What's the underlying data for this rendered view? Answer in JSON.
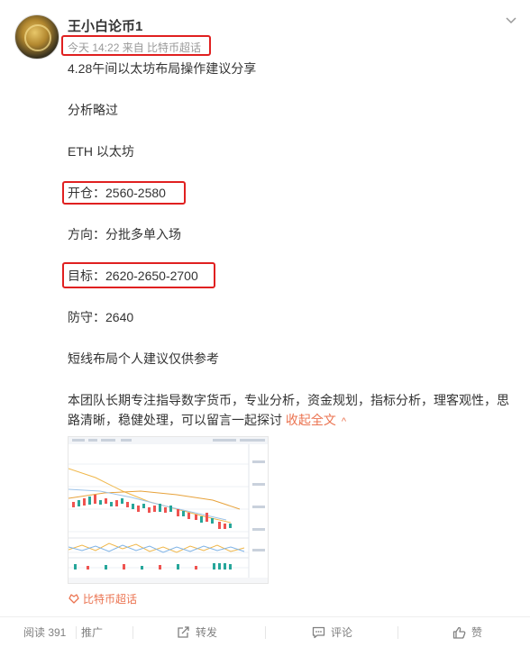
{
  "post": {
    "username": "王小白论币1",
    "meta": "今天 14:22 来自 比特币超话",
    "lines": [
      "4.28午间以太坊布局操作建议分享",
      "分析略过",
      "ETH  以太坊",
      "开仓：2560-2580",
      "方向：分批多单入场",
      "目标：2620-2650-2700",
      "防守：2640",
      "短线布局个人建议仅供参考"
    ],
    "paragraph": "本团队长期专注指导数字货币，专业分析，资金规划，指标分析，理客观性，思路清晰，稳健处理，可以留言一起探讨",
    "collapse_label": "收起全文",
    "collapse_caret": "^",
    "topic_tag": "比特币超话"
  },
  "footer": {
    "views": "阅读 391",
    "promote": "推广",
    "repost": "转发",
    "comment": "评论",
    "like": "赞"
  },
  "icons": [
    "avatar",
    "chevron-down-icon",
    "super-topic-icon",
    "repost-icon",
    "comment-icon",
    "like-icon"
  ],
  "colors": {
    "accent_link": "#eb7350",
    "annotation_box": "#e02020",
    "meta_text": "#999999",
    "body_text": "#333333"
  }
}
